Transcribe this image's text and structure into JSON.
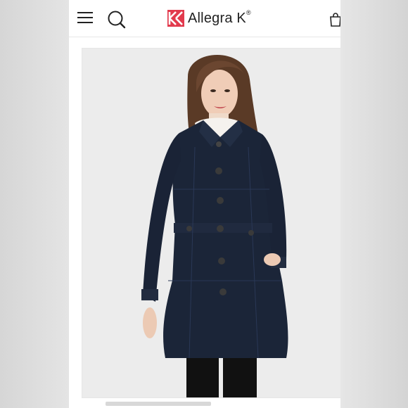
{
  "header": {
    "menu_icon": "hamburger-menu-icon",
    "search_icon": "search-icon",
    "brand_name": "Allegra K",
    "brand_mark": "®",
    "bag_icon": "shopping-bag-icon"
  },
  "product": {
    "image_description_icon": "product-photo",
    "coat_color": "#1b2538",
    "background_color": "#ececec"
  },
  "colors": {
    "brand_red": "#e23a4d",
    "text": "#222222"
  }
}
